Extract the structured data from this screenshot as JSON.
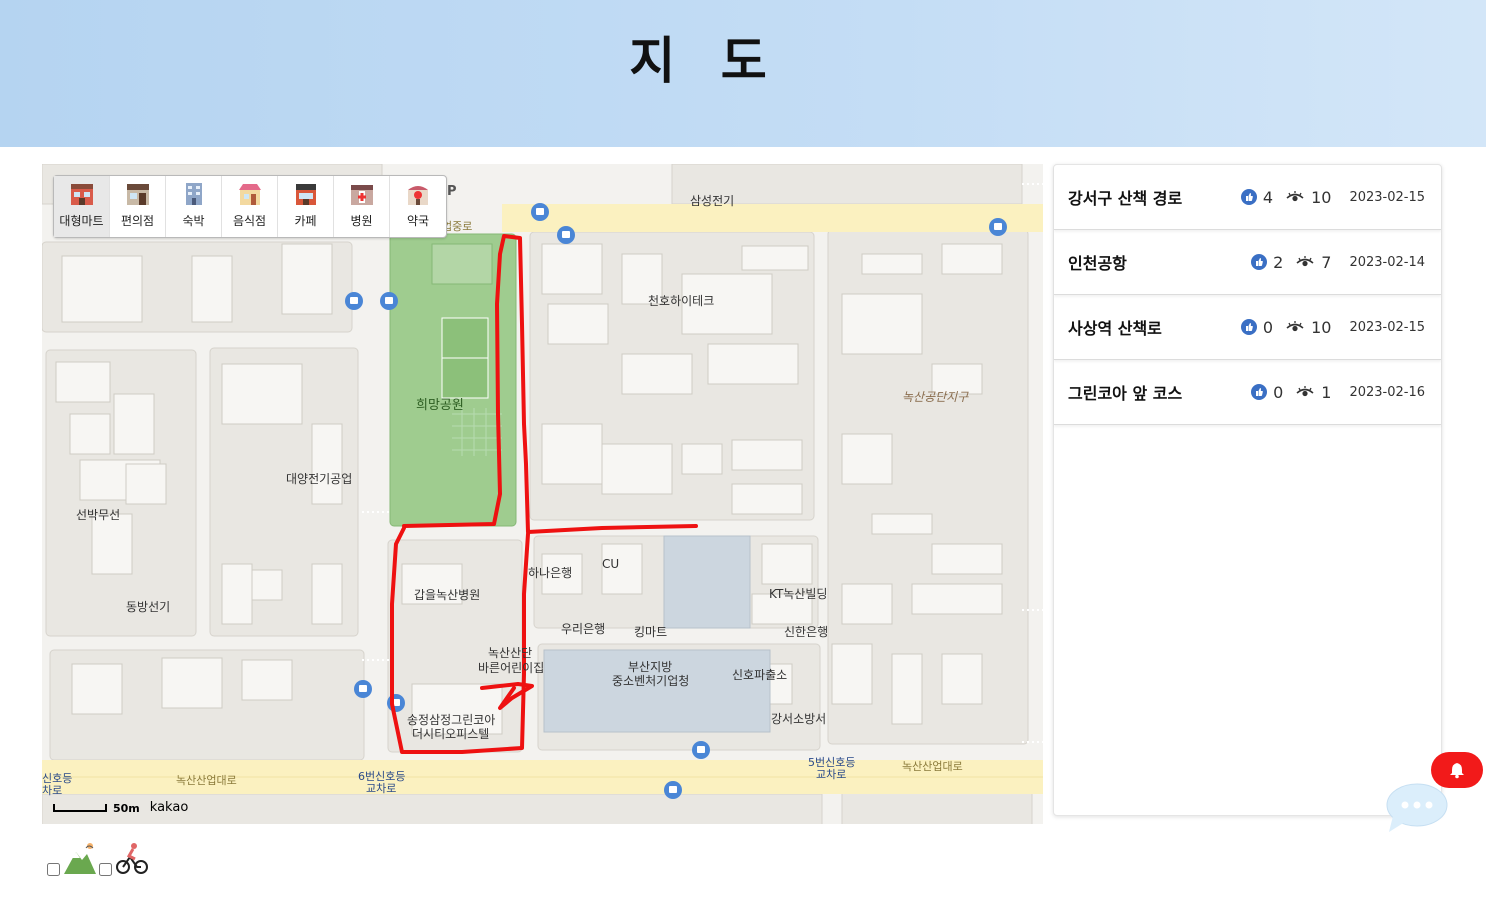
{
  "header": {
    "title": "지 도"
  },
  "categories": [
    {
      "label": "대형마트",
      "icon": "mart-icon"
    },
    {
      "label": "편의점",
      "icon": "convenience-store-icon"
    },
    {
      "label": "숙박",
      "icon": "hotel-icon"
    },
    {
      "label": "음식점",
      "icon": "restaurant-icon"
    },
    {
      "label": "카페",
      "icon": "cafe-icon"
    },
    {
      "label": "병원",
      "icon": "hospital-icon"
    },
    {
      "label": "약국",
      "icon": "pharmacy-icon"
    }
  ],
  "map": {
    "labels": {
      "samsung": "삼성전기",
      "cheonho": "천호하이테크",
      "park": "희망공원",
      "daeyang": "대양전기공업",
      "seonbak": "선박무선",
      "dongbang": "동방선기",
      "industrial_zone": "녹산공단지구",
      "hana": "하나은행",
      "cu": "CU",
      "kt": "KT녹산빌딩",
      "woori": "우리은행",
      "kingmart": "킹마트",
      "shinhan": "신한은행",
      "hospital": "갑을녹산병원",
      "clinic_line1": "녹산산단",
      "clinic_line2": "바른어린이집",
      "busan_line1": "부산지방",
      "busan_line2": "중소벤처기업청",
      "police": "신호파출소",
      "fire": "강서소방서",
      "officetel_line1": "송정삼정그린코아",
      "officetel_line2": "더시티오피스텔",
      "road_main_left": "녹산산업대로",
      "road_main_right": "녹산산업대로",
      "road_top": "업중로",
      "crossing6_line1": "6번신호등",
      "crossing6_line2": "교차로",
      "crossing5_line1": "5번신호등",
      "crossing5_line2": "교차로",
      "crossing_left_line1": "신호등",
      "crossing_left_line2": "차로",
      "parking": "P"
    },
    "scale": {
      "distance": "50m",
      "brand": "kakao"
    },
    "route_color": "#ee1111"
  },
  "routes": [
    {
      "name": "강서구 산책 경로",
      "likes": "4",
      "views": "10",
      "date": "2023-02-15"
    },
    {
      "name": "인천공항",
      "likes": "2",
      "views": "7",
      "date": "2023-02-14"
    },
    {
      "name": "사상역 산책로",
      "likes": "0",
      "views": "10",
      "date": "2023-02-15"
    },
    {
      "name": "그린코아 앞 코스",
      "likes": "0",
      "views": "1",
      "date": "2023-02-16"
    }
  ],
  "filters": [
    {
      "icon": "hiking-mountain-icon",
      "checked": false
    },
    {
      "icon": "cyclist-icon",
      "checked": false
    }
  ],
  "colors": {
    "header_bg": "#bdd8f3",
    "alert": "#f21a1a",
    "like": "#3a6fc4"
  }
}
